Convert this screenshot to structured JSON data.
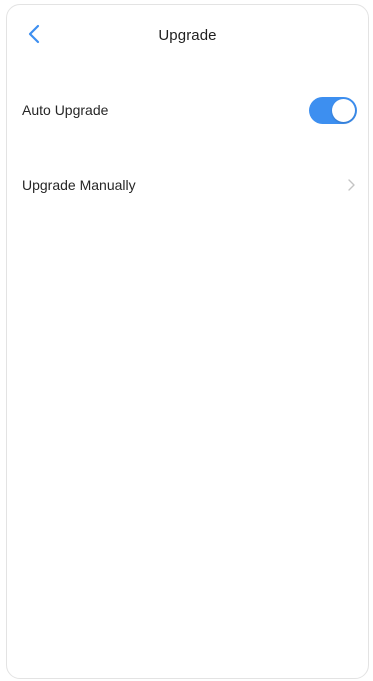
{
  "header": {
    "title": "Upgrade",
    "back_icon": "chevron-left-icon"
  },
  "settings": [
    {
      "label": "Auto Upgrade",
      "control": "toggle",
      "enabled": true
    },
    {
      "label": "Upgrade Manually",
      "control": "chevron",
      "icon": "chevron-right-icon"
    }
  ],
  "colors": {
    "accent": "#3d8ff0",
    "text": "#262626",
    "chevron": "#c4c4c4"
  }
}
